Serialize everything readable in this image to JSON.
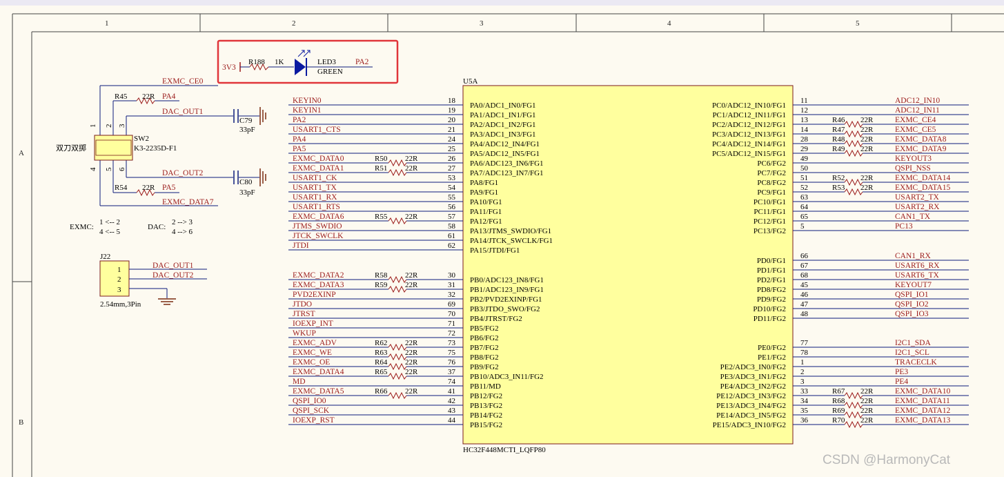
{
  "border": {
    "columns": [
      "1",
      "2",
      "3",
      "4",
      "5"
    ],
    "rows": [
      "A",
      "B"
    ]
  },
  "led": {
    "net_left": "3V3",
    "resistor": "R188",
    "resistor_value": "1K",
    "ref": "LED3",
    "color": "GREEN",
    "net_right": "PA2",
    "highlight_color": "#e0353a"
  },
  "switch": {
    "ref": "SW2",
    "part": "K3-2235D-F1",
    "label_cn": "双刀双掷",
    "pins": [
      "1",
      "2",
      "3",
      "4",
      "5",
      "6"
    ],
    "nets": {
      "ce0": "EXMC_CE0",
      "dac1": "DAC_OUT1",
      "dac2": "DAC_OUT2",
      "data7": "EXMC_DATA7",
      "pa4": "PA4",
      "pa5": "PA5"
    },
    "r45": "R45",
    "r45_val": "22R",
    "r54": "R54",
    "r54_val": "22R",
    "c79": "C79",
    "c79_val": "33pF",
    "c80": "C80",
    "c80_val": "33pF"
  },
  "mapping": {
    "exmc_title": "EXMC:",
    "exmc_1": "1 <-- 2",
    "exmc_2": "4 <-- 5",
    "dac_title": "DAC:",
    "dac_1": "2 --> 3",
    "dac_2": "4 --> 6"
  },
  "j22": {
    "ref": "J22",
    "pins": [
      "1",
      "2",
      "3"
    ],
    "nets": [
      "DAC_OUT1",
      "DAC_OUT2"
    ],
    "desc": "2.54mm,3Pin"
  },
  "mcu": {
    "ref": "U5A",
    "part": "HC32F448MCTI_LQFP80",
    "body_color": "#ffff9e",
    "left_a": [
      {
        "net": "KEYIN0",
        "num": "18",
        "pin": "PA0/ADC1_IN0/FG1"
      },
      {
        "net": "KEYIN1",
        "num": "19",
        "pin": "PA1/ADC1_IN1/FG1"
      },
      {
        "net": "PA2",
        "num": "20",
        "pin": "PA2/ADC1_IN2/FG1"
      },
      {
        "net": "USART1_CTS",
        "num": "21",
        "pin": "PA3/ADC1_IN3/FG1"
      },
      {
        "net": "PA4",
        "num": "24",
        "pin": "PA4/ADC12_IN4/FG1"
      },
      {
        "net": "PA5",
        "num": "25",
        "pin": "PA5/ADC12_IN5/FG1"
      },
      {
        "net": "EXMC_DATA0",
        "num": "26",
        "pin": "PA6/ADC123_IN6/FG1",
        "r": "R50",
        "rv": "22R"
      },
      {
        "net": "EXMC_DATA1",
        "num": "27",
        "pin": "PA7/ADC123_IN7/FG1",
        "r": "R51",
        "rv": "22R"
      },
      {
        "net": "USART1_CK",
        "num": "53",
        "pin": "PA8/FG1"
      },
      {
        "net": "USART1_TX",
        "num": "54",
        "pin": "PA9/FG1"
      },
      {
        "net": "USART1_RX",
        "num": "55",
        "pin": "PA10/FG1"
      },
      {
        "net": "USART1_RTS",
        "num": "56",
        "pin": "PA11/FG1"
      },
      {
        "net": "EXMC_DATA6",
        "num": "57",
        "pin": "PA12/FG1",
        "r": "R55",
        "rv": "22R"
      },
      {
        "net": "JTMS_SWDIO",
        "num": "58",
        "pin": "PA13/JTMS_SWDIO/FG1"
      },
      {
        "net": "JTCK_SWCLK",
        "num": "61",
        "pin": "PA14/JTCK_SWCLK/FG1"
      },
      {
        "net": "JTDI",
        "num": "62",
        "pin": "PA15/JTDI/FG1"
      }
    ],
    "left_b": [
      {
        "net": "EXMC_DATA2",
        "num": "30",
        "pin": "PB0/ADC123_IN8/FG1",
        "r": "R58",
        "rv": "22R"
      },
      {
        "net": "EXMC_DATA3",
        "num": "31",
        "pin": "PB1/ADC123_IN9/FG1",
        "r": "R59",
        "rv": "22R"
      },
      {
        "net": "PVD2EXINP",
        "num": "32",
        "pin": "PB2/PVD2EXINP/FG1"
      },
      {
        "net": "JTDO",
        "num": "69",
        "pin": "PB3/JTDO_SWO/FG2"
      },
      {
        "net": "JTRST",
        "num": "70",
        "pin": "PB4/JTRST/FG2"
      },
      {
        "net": "IOEXP_INT",
        "num": "71",
        "pin": "PB5/FG2"
      },
      {
        "net": "WKUP",
        "num": "72",
        "pin": "PB6/FG2"
      },
      {
        "net": "EXMC_ADV",
        "num": "73",
        "pin": "PB7/FG2",
        "r": "R62",
        "rv": "22R"
      },
      {
        "net": "EXMC_WE",
        "num": "75",
        "pin": "PB8/FG2",
        "r": "R63",
        "rv": "22R"
      },
      {
        "net": "EXMC_OE",
        "num": "76",
        "pin": "PB9/FG2",
        "r": "R64",
        "rv": "22R"
      },
      {
        "net": "EXMC_DATA4",
        "num": "37",
        "pin": "PB10/ADC3_IN11/FG2",
        "r": "R65",
        "rv": "22R"
      },
      {
        "net": "MD",
        "num": "74",
        "pin": "PB11/MD"
      },
      {
        "net": "EXMC_DATA5",
        "num": "41",
        "pin": "PB12/FG2",
        "r": "R66",
        "rv": "22R"
      },
      {
        "net": "QSPI_IO0",
        "num": "42",
        "pin": "PB13/FG2"
      },
      {
        "net": "QSPI_SCK",
        "num": "43",
        "pin": "PB14/FG2"
      },
      {
        "net": "IOEXP_RST",
        "num": "44",
        "pin": "PB15/FG2"
      }
    ],
    "right_c": [
      {
        "net": "ADC12_IN10",
        "num": "11",
        "pin": "PC0/ADC12_IN10/FG1"
      },
      {
        "net": "ADC12_IN11",
        "num": "12",
        "pin": "PC1/ADC12_IN11/FG1"
      },
      {
        "net": "EXMC_CE4",
        "num": "13",
        "pin": "PC2/ADC12_IN12/FG1",
        "r": "R46",
        "rv": "22R"
      },
      {
        "net": "EXMC_CE5",
        "num": "14",
        "pin": "PC3/ADC12_IN13/FG1",
        "r": "R47",
        "rv": "22R"
      },
      {
        "net": "EXMC_DATA8",
        "num": "28",
        "pin": "PC4/ADC12_IN14/FG1",
        "r": "R48",
        "rv": "22R"
      },
      {
        "net": "EXMC_DATA9",
        "num": "29",
        "pin": "PC5/ADC12_IN15/FG1",
        "r": "R49",
        "rv": "22R"
      },
      {
        "net": "KEYOUT3",
        "num": "49",
        "pin": "PC6/FG2"
      },
      {
        "net": "QSPI_NSS",
        "num": "50",
        "pin": "PC7/FG2"
      },
      {
        "net": "EXMC_DATA14",
        "num": "51",
        "pin": "PC8/FG2",
        "r": "R52",
        "rv": "22R"
      },
      {
        "net": "EXMC_DATA15",
        "num": "52",
        "pin": "PC9/FG1",
        "r": "R53",
        "rv": "22R"
      },
      {
        "net": "USART2_TX",
        "num": "63",
        "pin": "PC10/FG1"
      },
      {
        "net": "USART2_RX",
        "num": "64",
        "pin": "PC11/FG1"
      },
      {
        "net": "CAN1_TX",
        "num": "65",
        "pin": "PC12/FG1"
      },
      {
        "net": "PC13",
        "num": "5",
        "pin": "PC13/FG2"
      }
    ],
    "right_d": [
      {
        "net": "CAN1_RX",
        "num": "66",
        "pin": "PD0/FG1"
      },
      {
        "net": "USART6_RX",
        "num": "67",
        "pin": "PD1/FG1"
      },
      {
        "net": "USART6_TX",
        "num": "68",
        "pin": "PD2/FG1"
      },
      {
        "net": "KEYOUT7",
        "num": "45",
        "pin": "PD8/FG2"
      },
      {
        "net": "QSPI_IO1",
        "num": "46",
        "pin": "PD9/FG2"
      },
      {
        "net": "QSPI_IO2",
        "num": "47",
        "pin": "PD10/FG2"
      },
      {
        "net": "QSPI_IO3",
        "num": "48",
        "pin": "PD11/FG2"
      }
    ],
    "right_e": [
      {
        "net": "I2C1_SDA",
        "num": "77",
        "pin": "PE0/FG2"
      },
      {
        "net": "I2C1_SCL",
        "num": "78",
        "pin": "PE1/FG2"
      },
      {
        "net": "TRACECLK",
        "num": "1",
        "pin": "PE2/ADC3_IN0/FG2"
      },
      {
        "net": "PE3",
        "num": "2",
        "pin": "PE3/ADC3_IN1/FG2"
      },
      {
        "net": "PE4",
        "num": "3",
        "pin": "PE4/ADC3_IN2/FG2"
      },
      {
        "net": "EXMC_DATA10",
        "num": "33",
        "pin": "PE12/ADC3_IN3/FG2",
        "r": "R67",
        "rv": "22R"
      },
      {
        "net": "EXMC_DATA11",
        "num": "34",
        "pin": "PE13/ADC3_IN4/FG2",
        "r": "R68",
        "rv": "22R"
      },
      {
        "net": "EXMC_DATA12",
        "num": "35",
        "pin": "PE14/ADC3_IN5/FG2",
        "r": "R69",
        "rv": "22R"
      },
      {
        "net": "EXMC_DATA13",
        "num": "36",
        "pin": "PE15/ADC3_IN10/FG2",
        "r": "R70",
        "rv": "22R"
      }
    ]
  },
  "watermark": "CSDN @HarmonyCat"
}
